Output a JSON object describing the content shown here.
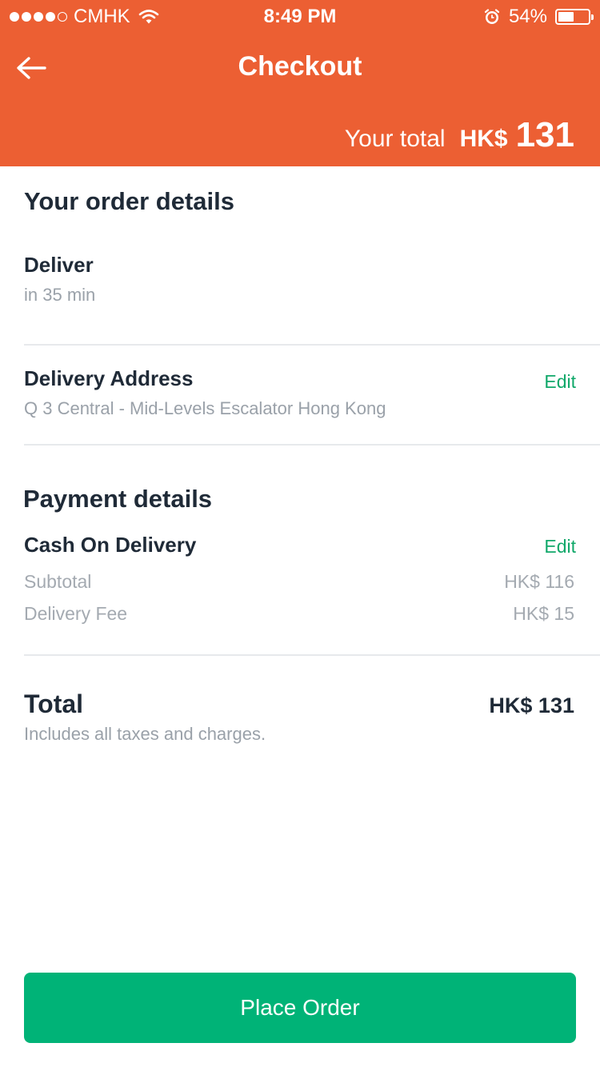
{
  "status_bar": {
    "carrier": "CMHK",
    "time": "8:49 PM",
    "battery": "54%",
    "battery_level": 0.54,
    "signal_bars": 4
  },
  "header": {
    "title": "Checkout",
    "total_label": "Your total",
    "total_currency": "HK$",
    "total_amount": "131",
    "background": "#ec5f33"
  },
  "order": {
    "section_title": "Your order details",
    "deliver_label": "Deliver",
    "deliver_time": "in 35 min",
    "address_label": "Delivery Address",
    "address_value": "Q 3 Central - Mid-Levels Escalator Hong Kong",
    "address_edit": "Edit"
  },
  "payment": {
    "section_title": "Payment details",
    "method": "Cash On Delivery",
    "method_edit": "Edit",
    "subtotal_label": "Subtotal",
    "subtotal_value": "HK$ 116",
    "fee_label": "Delivery Fee",
    "fee_value": "HK$ 15"
  },
  "total": {
    "label": "Total",
    "value": "HK$ 131",
    "note": "Includes all taxes and charges."
  },
  "place_order": {
    "label": "Place Order",
    "color": "#00b377"
  },
  "icons": {
    "back": "arrow-left-icon",
    "wifi": "wifi-icon",
    "alarm": "alarm-icon",
    "battery": "battery-icon"
  }
}
